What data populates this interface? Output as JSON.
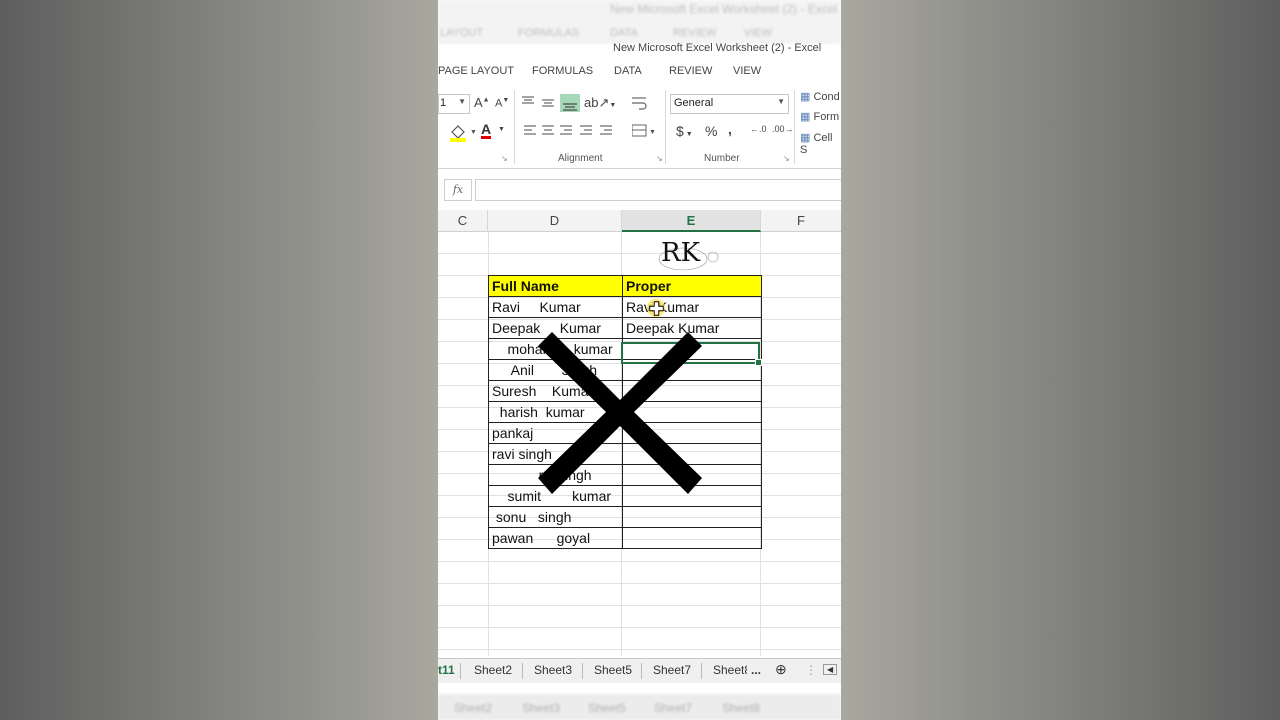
{
  "window": {
    "title": "New Microsoft Excel Worksheet (2) - Excel",
    "ghost_title": "New Microsoft Excel Worksheet (2) - Excel",
    "ghost_tabs": [
      "LAYOUT",
      "FORMULAS",
      "DATA",
      "REVIEW",
      "VIEW"
    ]
  },
  "ribbon_tabs": [
    "PAGE LAYOUT",
    "FORMULAS",
    "DATA",
    "REVIEW",
    "VIEW"
  ],
  "ribbon": {
    "font_size_value": "1",
    "alignment_label": "Alignment",
    "number_label": "Number",
    "number_format_value": "General",
    "currency_symbol": "$",
    "percent_symbol": "%",
    "comma_symbol": ",",
    "styles_items": [
      "Cond",
      "Form",
      "Cell S"
    ],
    "grow_font": "A",
    "shrink_font": "A",
    "font_color": "A"
  },
  "formula_bar": {
    "fx_label": "fx",
    "value": ""
  },
  "columns": [
    "C",
    "D",
    "E",
    "F"
  ],
  "selected_column": "E",
  "logo_text": "RK",
  "table": {
    "headers": [
      "Full Name",
      "Proper"
    ],
    "rows": [
      [
        "Ravi     Kumar",
        "Ravi Kumar"
      ],
      [
        "Deepak     Kumar",
        "Deepak Kumar"
      ],
      [
        "    mohan      kumar",
        ""
      ],
      [
        "     Anil       Singh",
        ""
      ],
      [
        "Suresh    Kumar",
        ""
      ],
      [
        "  harish  kumar",
        ""
      ],
      [
        "pankaj",
        ""
      ],
      [
        "ravi singh",
        ""
      ],
      [
        "            raj singh",
        ""
      ],
      [
        "    sumit        kumar",
        ""
      ],
      [
        " sonu   singh",
        ""
      ],
      [
        "pawan      goyal",
        ""
      ]
    ]
  },
  "sheet_tabs": [
    "t11",
    "Sheet2",
    "Sheet3",
    "Sheet5",
    "Sheet7",
    "Sheet8"
  ],
  "active_sheet": "t11",
  "sheet_tabs_more": "...",
  "ghost_sheet_tabs": [
    "Sheet2",
    "Sheet3",
    "Sheet5",
    "Sheet7",
    "Sheet8"
  ],
  "colors": {
    "header_fill": "#ffff00",
    "excel_green": "#217346",
    "cross": "#000000"
  },
  "overlay_icon": "cross-mark-icon"
}
